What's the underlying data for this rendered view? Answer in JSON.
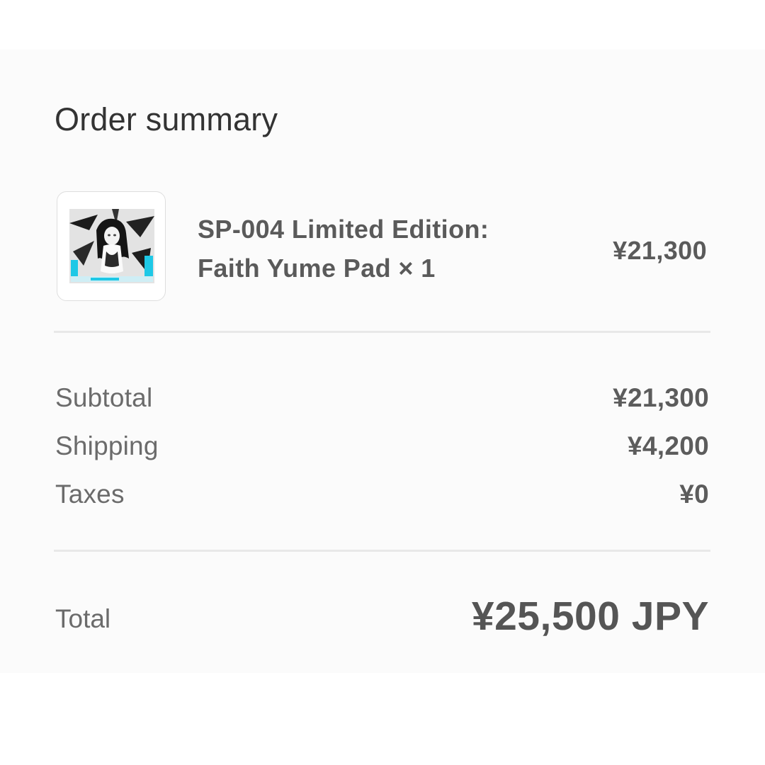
{
  "header": {
    "title": "Order summary"
  },
  "line_item": {
    "image_icon": "product-thumbnail-image",
    "name_line1": "SP-004 Limited Edition:",
    "name_line2": "Faith Yume Pad × 1",
    "price": "¥21,300"
  },
  "breakdown": [
    {
      "label": "Subtotal",
      "value": "¥21,300"
    },
    {
      "label": "Shipping",
      "value": "¥4,200"
    },
    {
      "label": "Taxes",
      "value": "¥0"
    }
  ],
  "total": {
    "label": "Total",
    "value": "¥25,500 JPY"
  },
  "colors": {
    "panel_bg": "#fbfbfb",
    "title_text": "#333333",
    "primary_text": "#5a5a5a",
    "secondary_text": "#6b6b6b",
    "divider": "#e8e8e8",
    "thumbnail_accent": "#1ec8e6"
  }
}
